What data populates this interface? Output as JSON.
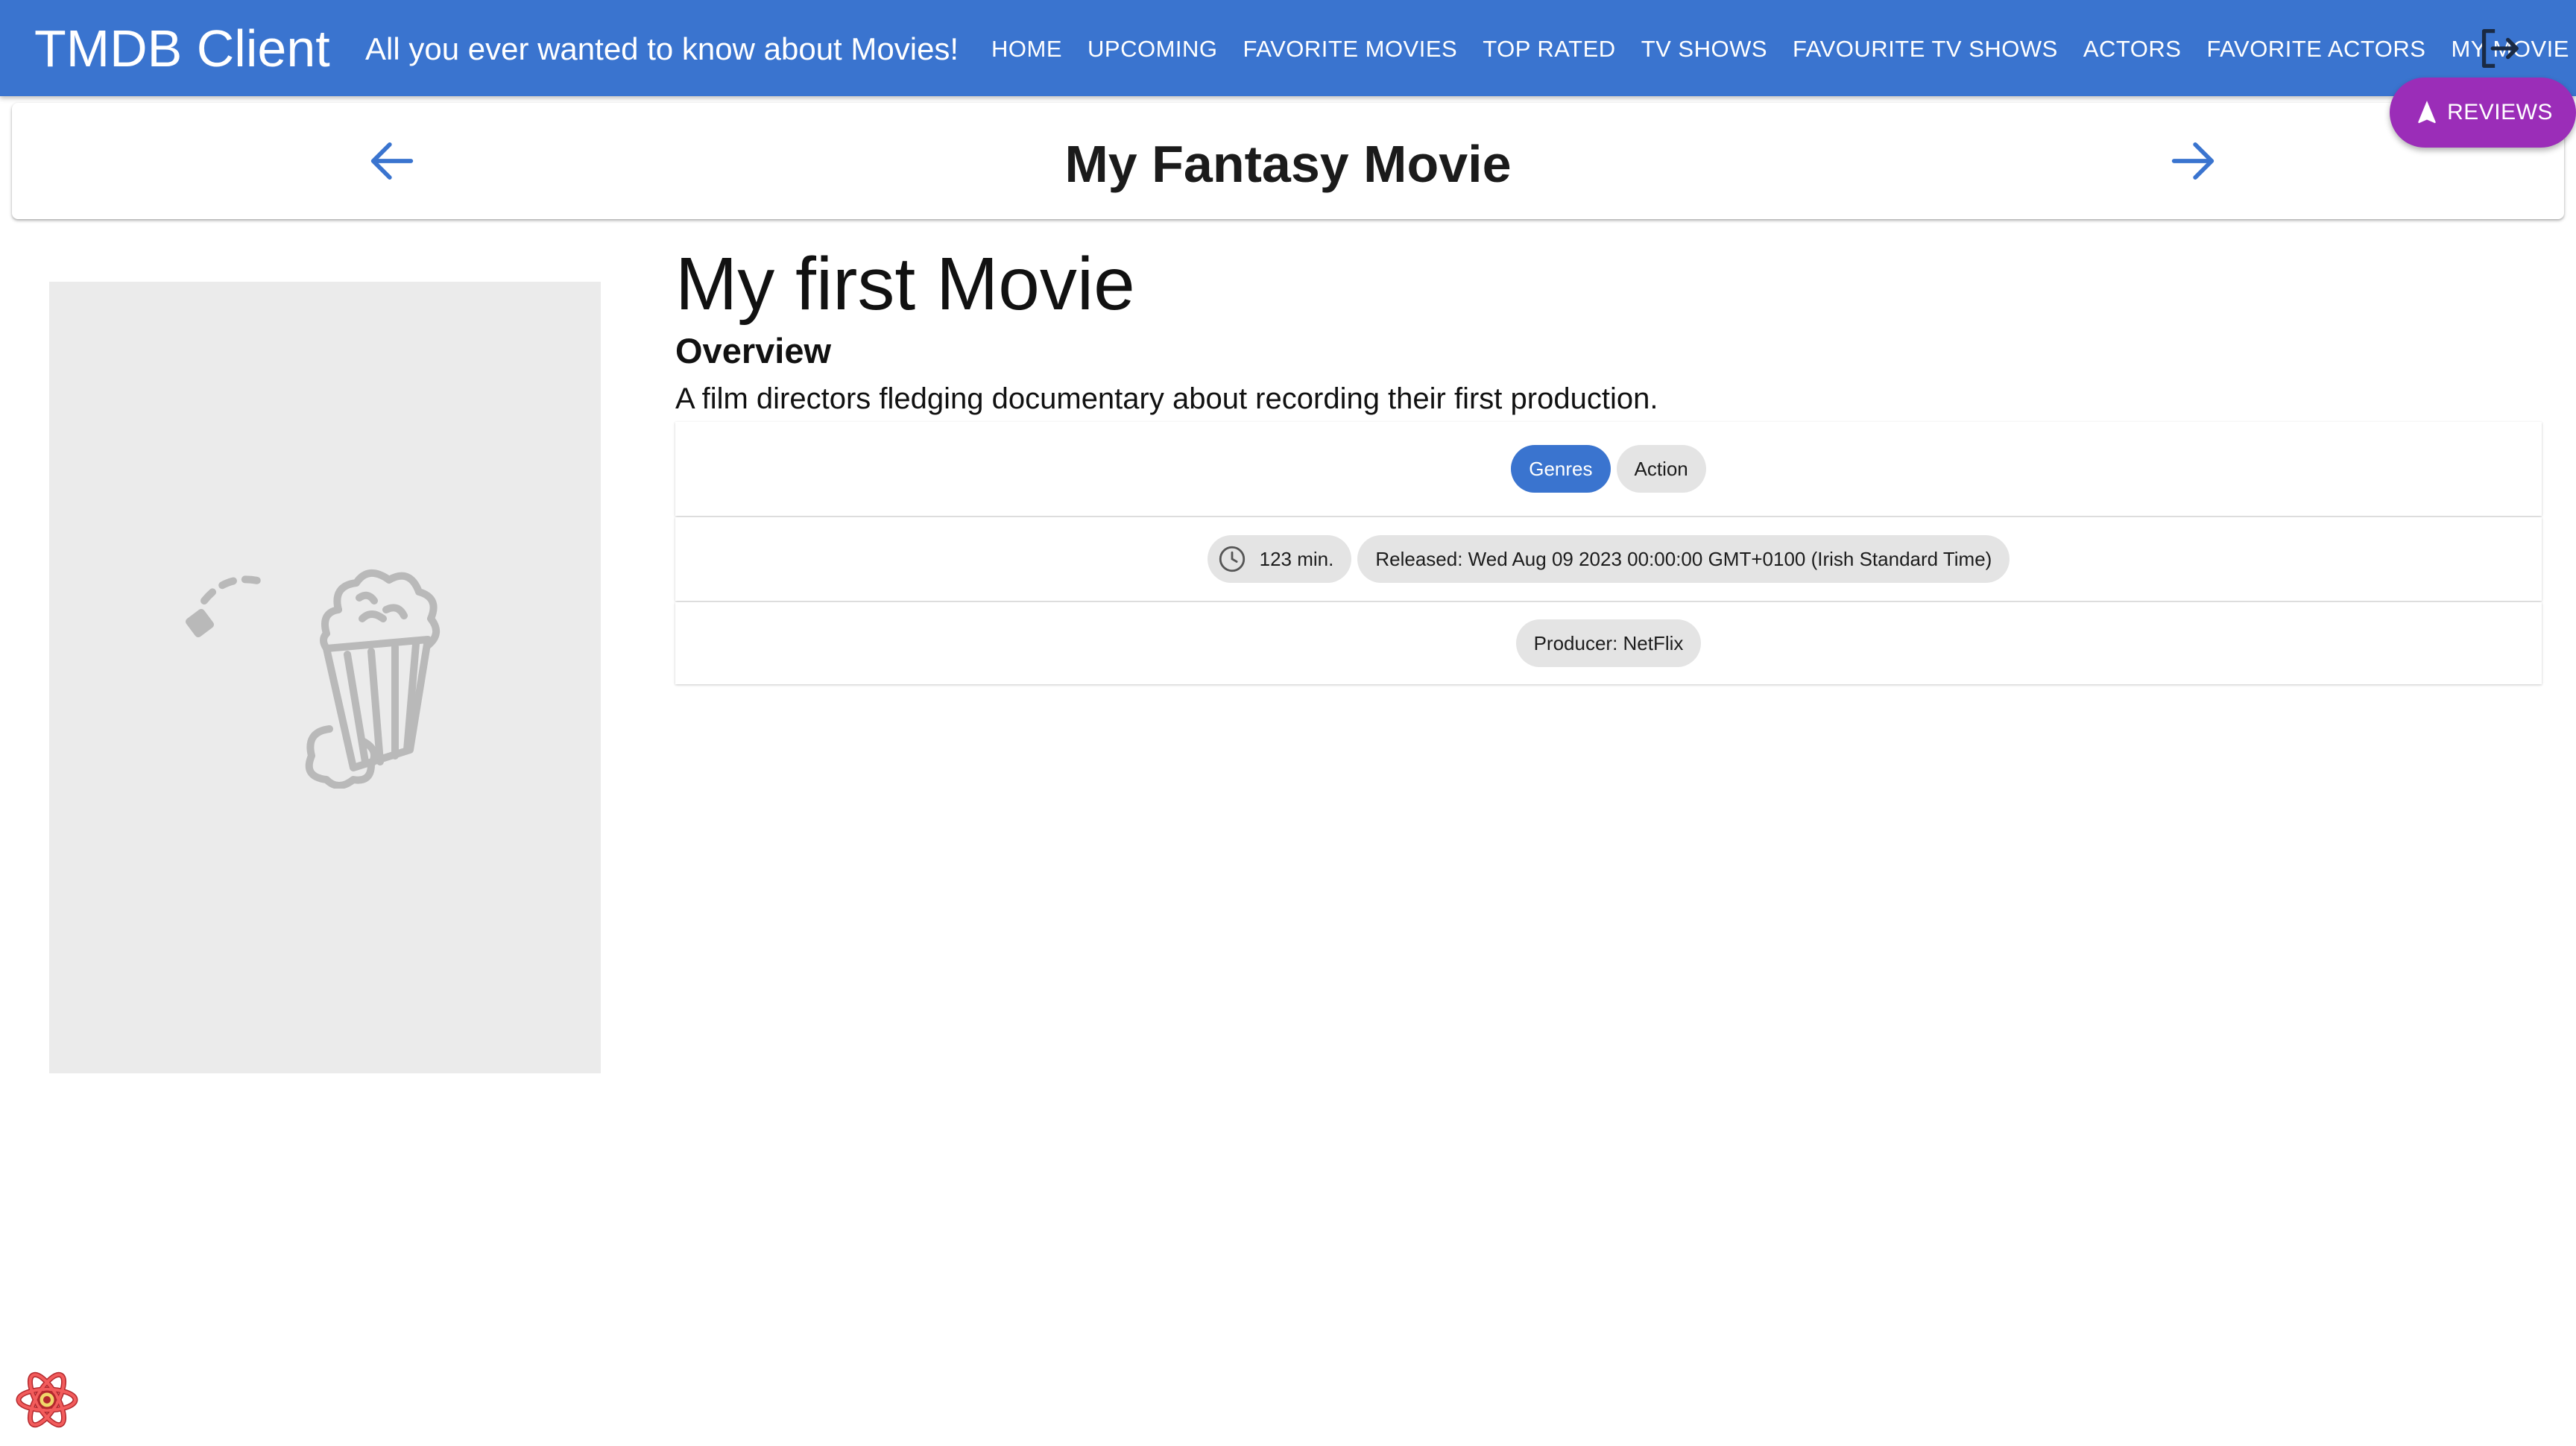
{
  "appbar": {
    "brand": "TMDB Client",
    "tagline": "All you ever wanted to know about Movies!",
    "nav": [
      {
        "label": "HOME"
      },
      {
        "label": "UPCOMING"
      },
      {
        "label": "FAVORITE MOVIES"
      },
      {
        "label": "TOP RATED"
      },
      {
        "label": "TV SHOWS"
      },
      {
        "label": "FAVOURITE TV SHOWS"
      },
      {
        "label": "ACTORS"
      },
      {
        "label": "FAVORITE ACTORS"
      },
      {
        "label": "MY MOVIE"
      }
    ],
    "logout_icon": "logout-icon"
  },
  "header": {
    "title": "My Fantasy Movie",
    "back_icon": "arrow-back-icon",
    "forward_icon": "arrow-forward-icon"
  },
  "fab": {
    "label": "REVIEWS",
    "icon": "navigation-icon",
    "color": "#9b2db8"
  },
  "movie": {
    "title": "My first Movie",
    "overview_heading": "Overview",
    "overview": "A film directors fledging documentary about recording their first production.",
    "genres_label": "Genres",
    "genres": [
      "Action"
    ],
    "runtime": "123 min.",
    "released": "Released: Wed Aug 09 2023 00:00:00 GMT+0100 (Irish Standard Time)",
    "producer": "Producer: NetFlix",
    "poster_placeholder_icon": "popcorn-icon"
  },
  "colors": {
    "appbar": "#3a74cf",
    "primary_chip": "#3a74cf",
    "chip": "#e4e4e4",
    "poster_bg": "#ebebeb"
  },
  "devtools_icon": "react-devtools-icon"
}
